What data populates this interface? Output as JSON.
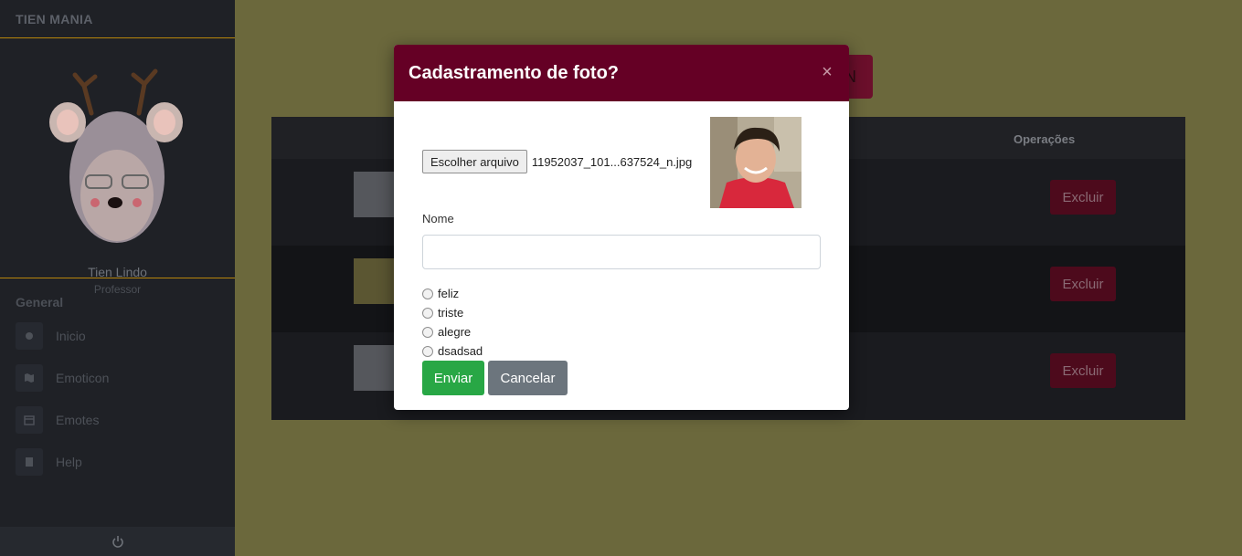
{
  "sidebar": {
    "brand": "TIEN MANIA",
    "user_name": "Tien Lindo",
    "user_role": "Professor",
    "section_title": "General",
    "items": [
      {
        "label": "Inicio",
        "icon": "circle-icon"
      },
      {
        "label": "Emoticon",
        "icon": "map-icon"
      },
      {
        "label": "Emotes",
        "icon": "calendar-icon"
      },
      {
        "label": "Help",
        "icon": "book-icon"
      }
    ],
    "footer_icon": "power-icon"
  },
  "background": {
    "table_header_ops": "Operações",
    "top_button_label": "N",
    "rows": [
      {
        "delete_label": "Excluir"
      },
      {
        "delete_label": "Excluir"
      },
      {
        "delete_label": "Excluir"
      }
    ]
  },
  "modal": {
    "title": "Cadastramento de foto?",
    "close_glyph": "×",
    "file_button": "Escolher arquivo",
    "file_name": "11952037_101...637524_n.jpg",
    "name_label": "Nome",
    "name_value": "",
    "options": [
      "feliz",
      "triste",
      "alegre",
      "dsadsad"
    ],
    "send_label": "Enviar",
    "cancel_label": "Cancelar"
  },
  "colors": {
    "header": "#650025",
    "send": "#28a745",
    "cancel": "#6c757d",
    "page_bg": "#6b683c",
    "sidebar_bg": "#1f2126"
  }
}
